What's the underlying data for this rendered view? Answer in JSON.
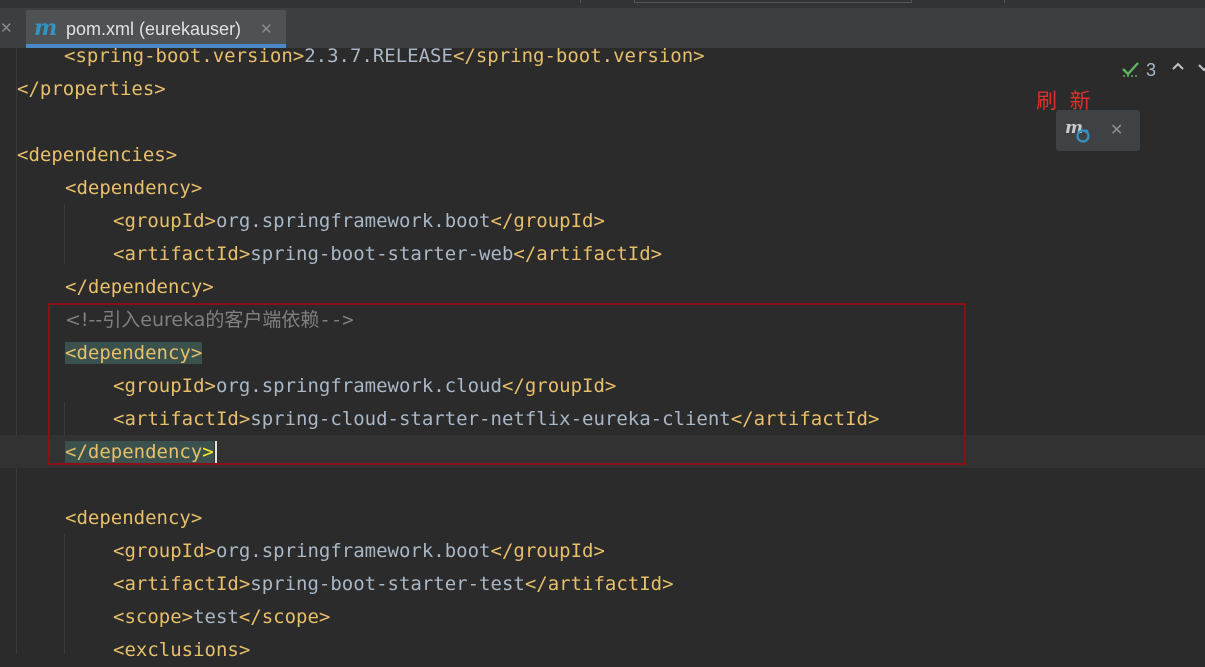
{
  "tab": {
    "icon": "maven-m-icon",
    "label": "pom.xml (eurekauser)",
    "close_glyph": "✕",
    "prev_tab_close_glyph": "✕"
  },
  "inspection": {
    "icon": "check-double-icon",
    "count": "3",
    "up_icon": "chevron-up-icon",
    "down_icon": "chevron-down-icon"
  },
  "annotation": {
    "label": "刷 新",
    "color": "#e0302e",
    "box_color": "#8b0f14"
  },
  "maven_popup": {
    "icon": "maven-reload-icon",
    "close_glyph": "✕"
  },
  "colors": {
    "editor_bg": "#2b2b2b",
    "tag": "#e8bf6a",
    "text": "#a9b7c6",
    "comment": "#808080",
    "tab_accent": "#4a88c7"
  },
  "code": {
    "line1": {
      "open": "<spring-boot.version>",
      "text": "2.3.7.RELEASE",
      "close": "</spring-boot.version>"
    },
    "line2": {
      "close": "</properties>"
    },
    "line4": {
      "open": "<dependencies>"
    },
    "line5": {
      "open": "<dependency>"
    },
    "line6": {
      "open": "<groupId>",
      "text": "org.springframework.boot",
      "close": "</groupId>"
    },
    "line7": {
      "open": "<artifactId>",
      "text": "spring-boot-starter-web",
      "close": "</artifactId>"
    },
    "line8": {
      "close": "</dependency>"
    },
    "line9": {
      "comment_start": "<!--引入",
      "comment_mid": "eureka",
      "comment_cjk": "的客户端依赖",
      "comment_end": "-->"
    },
    "line10": {
      "open": "<dependency>"
    },
    "line11": {
      "open": "<groupId>",
      "text": "org.springframework.cloud",
      "close": "</groupId>"
    },
    "line12": {
      "open": "<artifactId>",
      "text": "spring-cloud-starter-netflix-eureka-client",
      "close": "</artifactId>"
    },
    "line13": {
      "close_a": "</dependency",
      "close_b": ">"
    },
    "line15": {
      "open": "<dependency>"
    },
    "line16": {
      "open": "<groupId>",
      "text": "org.springframework.boot",
      "close": "</groupId>"
    },
    "line17": {
      "open": "<artifactId>",
      "text": "spring-boot-starter-test",
      "close": "</artifactId>"
    },
    "line18": {
      "open": "<scope>",
      "text": "test",
      "close": "</scope>"
    },
    "line19": {
      "open": "<exclusions>"
    }
  }
}
